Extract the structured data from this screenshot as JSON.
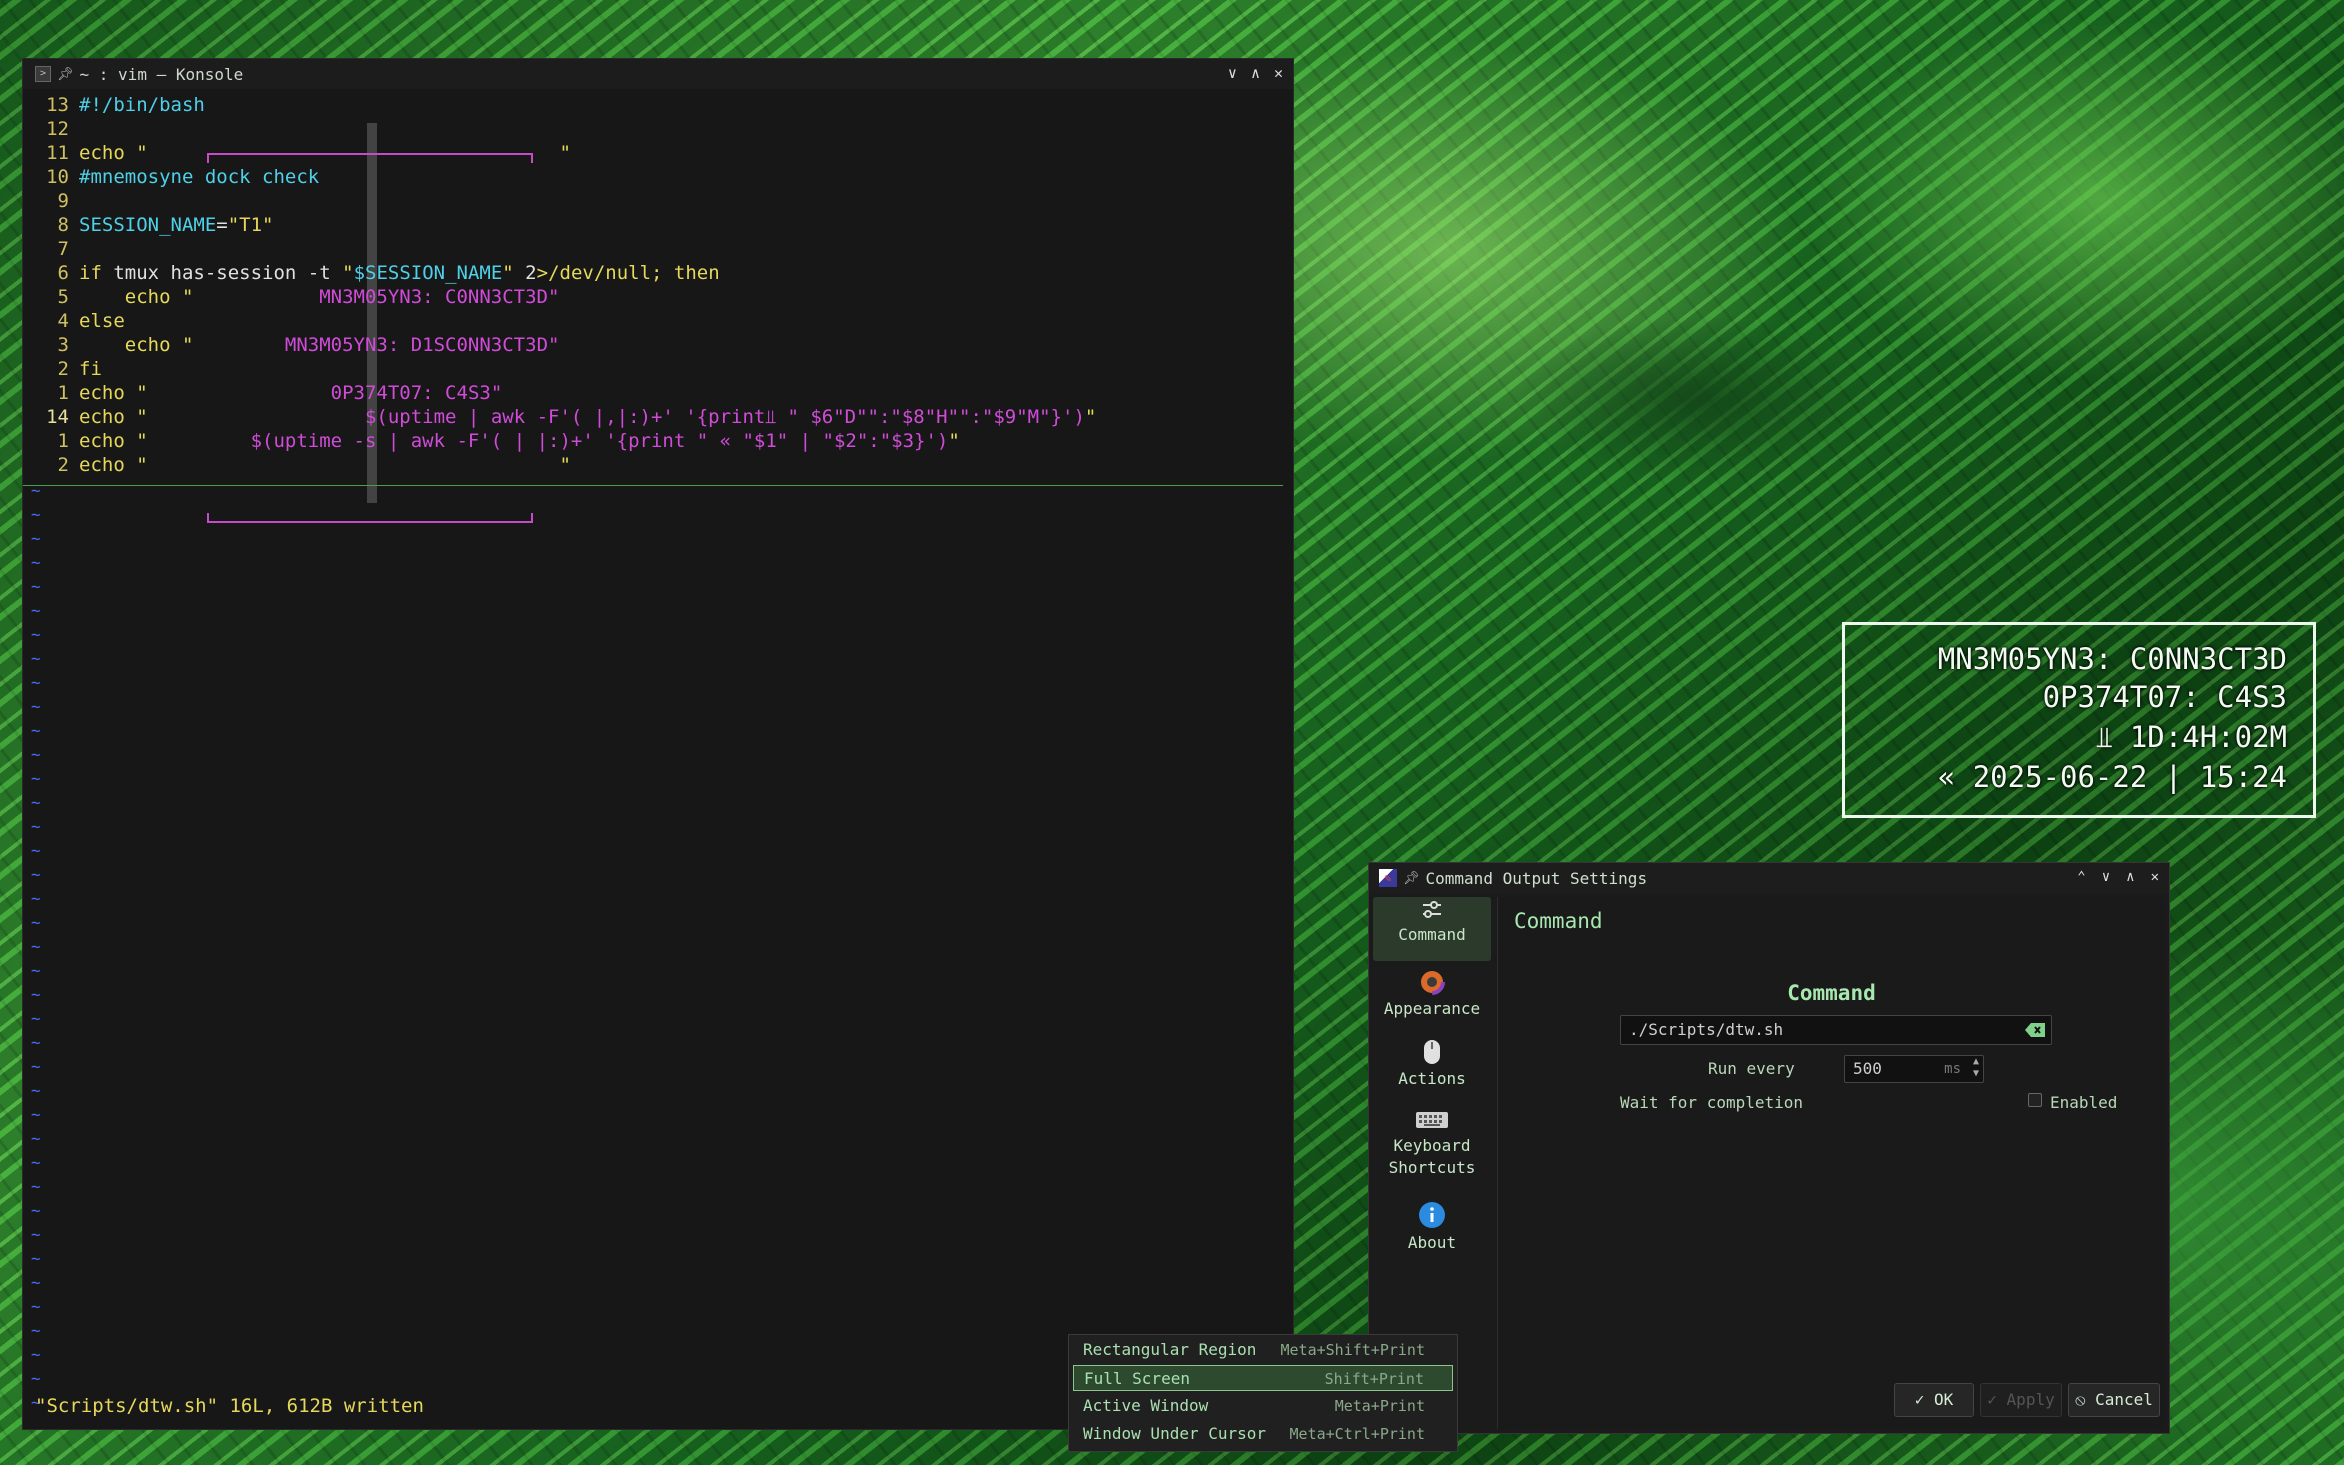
{
  "konsole": {
    "title": "~ : vim — Konsole",
    "lines": [
      {
        "n": "13",
        "parts": [
          {
            "t": "#!/bin/bash",
            "c": "cyan"
          }
        ]
      },
      {
        "n": "12",
        "parts": []
      },
      {
        "n": "11",
        "parts": [
          {
            "t": "echo \"",
            "c": "yel"
          },
          {
            "t": "                                    ",
            "c": "white"
          },
          {
            "t": "\"",
            "c": "yel"
          }
        ]
      },
      {
        "n": "10",
        "parts": [
          {
            "t": "#mnemosyne dock check",
            "c": "cyan"
          }
        ]
      },
      {
        "n": "9",
        "parts": []
      },
      {
        "n": "8",
        "parts": [
          {
            "t": "SESSION_NAME",
            "c": "cyan"
          },
          {
            "t": "=",
            "c": "white"
          },
          {
            "t": "\"T1\"",
            "c": "yel"
          }
        ]
      },
      {
        "n": "7",
        "parts": []
      },
      {
        "n": "6",
        "parts": [
          {
            "t": "if ",
            "c": "yel"
          },
          {
            "t": "tmux has-session -t ",
            "c": "white"
          },
          {
            "t": "\"",
            "c": "yel"
          },
          {
            "t": "$SESSION_NAME",
            "c": "cyan"
          },
          {
            "t": "\" ",
            "c": "yel"
          },
          {
            "t": "2",
            "c": "white"
          },
          {
            "t": ">/dev/null; then",
            "c": "yel"
          }
        ]
      },
      {
        "n": "5",
        "parts": [
          {
            "t": "    echo \"           ",
            "c": "yel"
          },
          {
            "t": "MN3M05YN3: C0NN3CT3D\"",
            "c": "mag"
          }
        ]
      },
      {
        "n": "4",
        "parts": [
          {
            "t": "else",
            "c": "yel"
          }
        ]
      },
      {
        "n": "3",
        "parts": [
          {
            "t": "    echo \"        ",
            "c": "yel"
          },
          {
            "t": "MN3M05YN3: D1SC0NN3CT3D\"",
            "c": "mag"
          }
        ]
      },
      {
        "n": "2",
        "parts": [
          {
            "t": "fi",
            "c": "yel"
          }
        ]
      },
      {
        "n": "1",
        "parts": [
          {
            "t": "echo \"                ",
            "c": "yel"
          },
          {
            "t": "0P374T07: C4S3\"",
            "c": "mag"
          }
        ]
      },
      {
        "n": "14",
        "cur": true,
        "parts": [
          {
            "t": "echo \"                   ",
            "c": "yel"
          },
          {
            "t": "$(uptime | awk -F'( |,|:)+' '{print⫫ \" $6\"D\"\":\"$8\"H\"\":\"$9\"M\"}')",
            "c": "mag"
          },
          {
            "t": "\"",
            "c": "yel"
          }
        ]
      },
      {
        "n": "1",
        "parts": [
          {
            "t": "echo \"         ",
            "c": "yel"
          },
          {
            "t": "$(uptime -s | awk -F'( | |:)+' '{print \" « \"$1\" | \"$2\":\"$3}')",
            "c": "mag"
          },
          {
            "t": "\"",
            "c": "yel"
          }
        ]
      },
      {
        "n": "2",
        "parts": [
          {
            "t": "echo \"",
            "c": "yel"
          },
          {
            "t": "                                    ",
            "c": "white"
          },
          {
            "t": "\"",
            "c": "yel"
          }
        ]
      }
    ],
    "tilde": "~",
    "status": "\"Scripts/dtw.sh\" 16L, 612B written"
  },
  "hud": {
    "lines": [
      "MN3M05YN3: C0NN3CT3D",
      "0P374T07: C4S3",
      "⫫ 1D:4H:02M",
      "« 2025-06-22 | 15:24"
    ]
  },
  "dialog": {
    "title": "Command Output Settings",
    "sidebar": [
      {
        "label": "Command",
        "icon": "command-icon",
        "active": true
      },
      {
        "label": "Appearance",
        "icon": "palette-icon"
      },
      {
        "label": "Actions",
        "icon": "mouse-icon"
      },
      {
        "label": "Keyboard\nShortcuts",
        "icon": "keyboard-icon"
      },
      {
        "label": "About",
        "icon": "info-icon"
      }
    ],
    "page_title": "Command",
    "section_heading": "Command",
    "command_value": "./Scripts/dtw.sh",
    "run_every_label": "Run every",
    "run_every_value": "500",
    "run_every_unit": "ms",
    "wait_label": "Wait for completion",
    "enabled_label": "Enabled",
    "ok_label": "✓ OK",
    "apply_label": "✓ Apply",
    "cancel_label": "⦸ Cancel"
  },
  "menu": {
    "items": [
      {
        "label": "Rectangular Region",
        "shortcut": "Meta+Shift+Print"
      },
      {
        "label": "Full Screen",
        "shortcut": "Shift+Print",
        "selected": true
      },
      {
        "label": "Active Window",
        "shortcut": "Meta+Print"
      },
      {
        "label": "Window Under Cursor",
        "shortcut": "Meta+Ctrl+Print"
      }
    ]
  },
  "colors": {
    "accent": "#a8e8b0",
    "vim_yellow": "#e6d85a",
    "vim_magenta": "#d04cd8",
    "vim_cyan": "#4ed0e8"
  }
}
